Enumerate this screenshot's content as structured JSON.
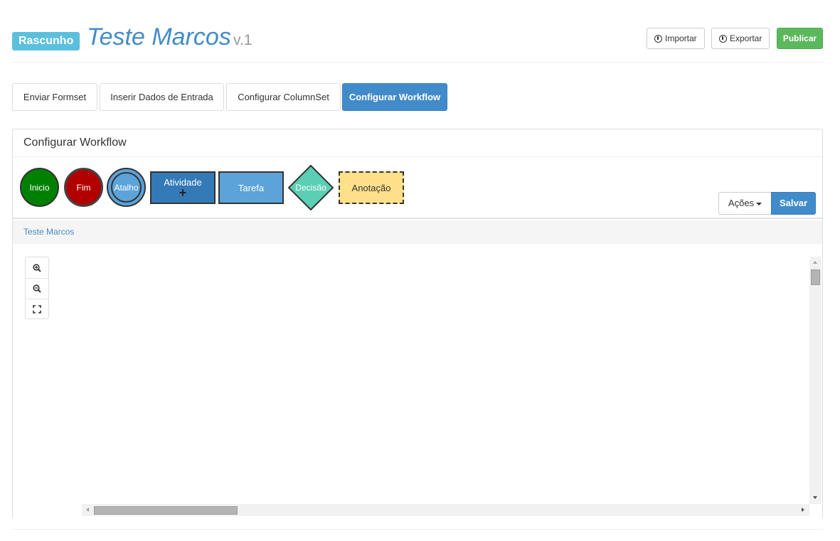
{
  "header": {
    "badge": "Rascunho",
    "title": "Teste Marcos",
    "version": "v.1",
    "import_label": "Importar",
    "export_label": "Exportar",
    "publish_label": "Publicar"
  },
  "tabs": [
    {
      "label": "Enviar Formset"
    },
    {
      "label": "Inserir Dados de Entrada"
    },
    {
      "label": "Configurar ColumnSet"
    },
    {
      "label": "Configurar Workflow"
    }
  ],
  "active_tab": "Configurar Workflow",
  "panel": {
    "title": "Configurar Workflow",
    "palette": {
      "inicio": "Inicio",
      "fim": "Fim",
      "atalho": "Atalho",
      "atividade": "Atividade",
      "tarefa": "Tarefa",
      "decisao": "Decisão",
      "anotacao": "Anotação"
    },
    "actions_label": "Ações",
    "save_label": "Salvar",
    "breadcrumb": "Teste Marcos"
  },
  "colors": {
    "accent": "#428bca",
    "badge": "#5bc0de",
    "publish": "#5cb85c",
    "inicio": "#008000",
    "fim": "#b20000",
    "atalho": "#5ba3d9",
    "atividade": "#337ab7",
    "tarefa": "#5ba3d9",
    "decisao": "#5bcfb4",
    "anotacao": "#ffe08a"
  },
  "icons": [
    "import-icon",
    "export-icon",
    "zoom-in-icon",
    "zoom-out-icon",
    "fit-screen-icon",
    "caret-down-icon",
    "plus-icon"
  ]
}
